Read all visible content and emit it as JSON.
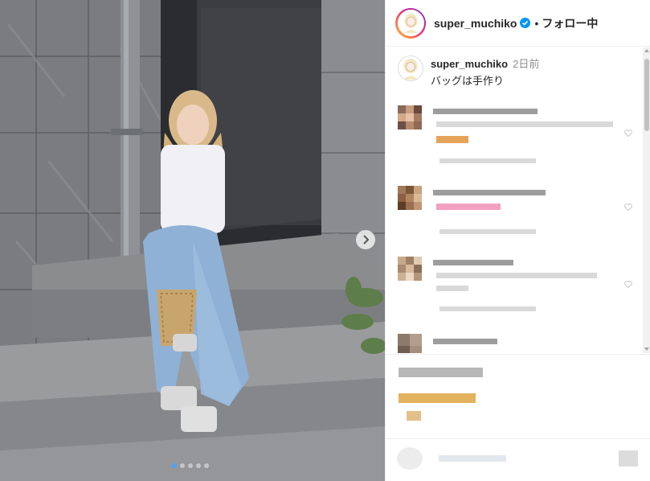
{
  "post": {
    "username": "super_muchiko",
    "separator": "•",
    "follow_status": "フォロー中",
    "photo_alt": "",
    "carousel": {
      "count": 5,
      "active_index": 0
    }
  },
  "caption": {
    "username": "super_muchiko",
    "time": "2日前",
    "text": "バッグは手作り"
  },
  "icons": {
    "verified": "verified-badge-icon",
    "next": "chevron-right-icon",
    "like": "heart-icon",
    "emoji": "emoji-icon"
  },
  "colors": {
    "verified_blue": "#0095f6",
    "text": "#262626",
    "muted": "#8e8e8e",
    "carousel_active": "#4aa1f5"
  }
}
